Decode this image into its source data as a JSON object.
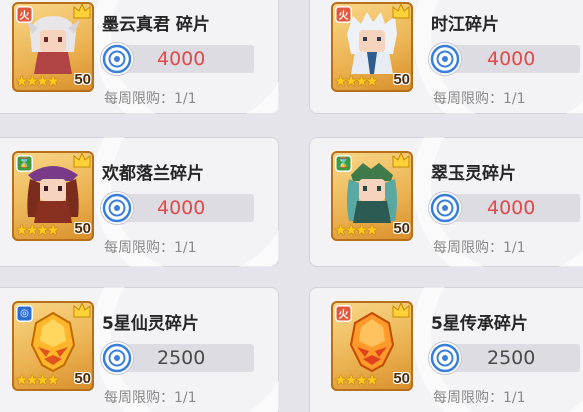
{
  "items": [
    {
      "name": "墨云真君 碎片",
      "price": "4000",
      "limit": "每周限购：1/1",
      "level": "50",
      "badge": "火",
      "badge_color": "red",
      "price_color": "red",
      "stars": "★★★★"
    },
    {
      "name": "时江碎片",
      "price": "4000",
      "limit": "每周限购：1/1",
      "level": "50",
      "badge": "火",
      "badge_color": "red",
      "price_color": "red",
      "stars": "★★★★"
    },
    {
      "name": "欢都落兰碎片",
      "price": "4000",
      "limit": "每周限购：1/1",
      "level": "50",
      "badge": "⌛",
      "badge_color": "green",
      "price_color": "red",
      "stars": "★★★★"
    },
    {
      "name": "翠玉灵碎片",
      "price": "4000",
      "limit": "每周限购：1/1",
      "level": "50",
      "badge": "⌛",
      "badge_color": "green",
      "price_color": "red",
      "stars": "★★★★"
    },
    {
      "name": "5星仙灵碎片",
      "price": "2500",
      "limit": "每周限购：1/1",
      "level": "50",
      "badge": "◎",
      "badge_color": "blue",
      "price_color": "gray",
      "stars": "★★★★"
    },
    {
      "name": "5星传承碎片",
      "price": "2500",
      "limit": "每周限购：1/1",
      "level": "50",
      "badge": "火",
      "badge_color": "red",
      "price_color": "gray",
      "stars": "★★★★"
    }
  ],
  "icons": {
    "currency": "coin-icon",
    "crown": "crown-icon"
  }
}
